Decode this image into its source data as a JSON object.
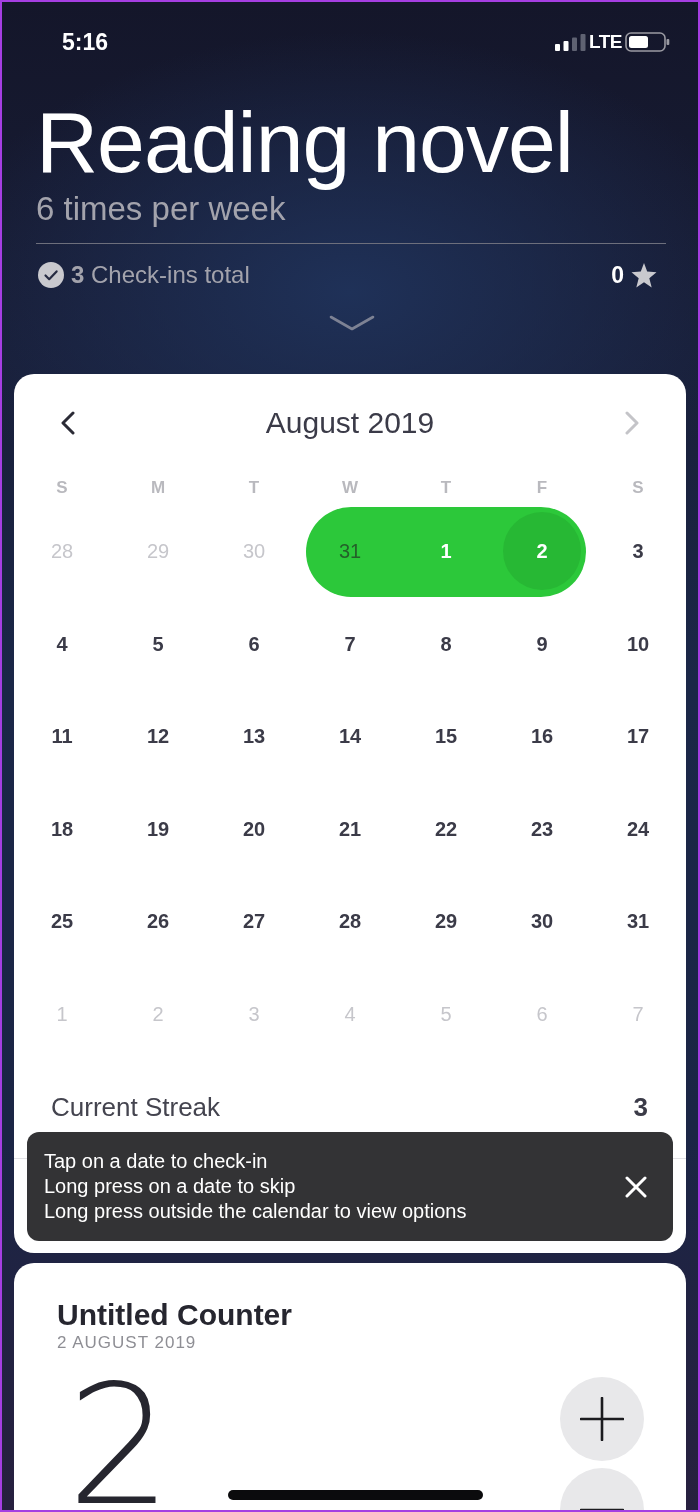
{
  "status_bar": {
    "time": "5:16",
    "network": "LTE"
  },
  "habit": {
    "title": "Reading novel",
    "frequency": "6 times per week",
    "checkins_text": "**3** Check-ins total",
    "star_count": "0"
  },
  "calendar": {
    "month": "August 2019",
    "prev_disabled": false,
    "next_disabled": true,
    "weekdays": [
      "S",
      "M",
      "T",
      "W",
      "T",
      "F",
      "S"
    ],
    "weeks": [
      [
        {
          "day": "28",
          "in_month": false,
          "checked": false,
          "today": false
        },
        {
          "day": "29",
          "in_month": false,
          "checked": false,
          "today": false
        },
        {
          "day": "30",
          "in_month": false,
          "checked": false,
          "today": false
        },
        {
          "day": "31",
          "in_month": false,
          "checked": true,
          "today": false
        },
        {
          "day": "1",
          "in_month": true,
          "checked": true,
          "today": false
        },
        {
          "day": "2",
          "in_month": true,
          "checked": true,
          "today": true
        },
        {
          "day": "3",
          "in_month": true,
          "checked": false,
          "today": false
        }
      ],
      [
        {
          "day": "4",
          "in_month": true,
          "checked": false,
          "today": false
        },
        {
          "day": "5",
          "in_month": true,
          "checked": false,
          "today": false
        },
        {
          "day": "6",
          "in_month": true,
          "checked": false,
          "today": false
        },
        {
          "day": "7",
          "in_month": true,
          "checked": false,
          "today": false
        },
        {
          "day": "8",
          "in_month": true,
          "checked": false,
          "today": false
        },
        {
          "day": "9",
          "in_month": true,
          "checked": false,
          "today": false
        },
        {
          "day": "10",
          "in_month": true,
          "checked": false,
          "today": false
        }
      ],
      [
        {
          "day": "11",
          "in_month": true,
          "checked": false,
          "today": false
        },
        {
          "day": "12",
          "in_month": true,
          "checked": false,
          "today": false
        },
        {
          "day": "13",
          "in_month": true,
          "checked": false,
          "today": false
        },
        {
          "day": "14",
          "in_month": true,
          "checked": false,
          "today": false
        },
        {
          "day": "15",
          "in_month": true,
          "checked": false,
          "today": false
        },
        {
          "day": "16",
          "in_month": true,
          "checked": false,
          "today": false
        },
        {
          "day": "17",
          "in_month": true,
          "checked": false,
          "today": false
        }
      ],
      [
        {
          "day": "18",
          "in_month": true,
          "checked": false,
          "today": false
        },
        {
          "day": "19",
          "in_month": true,
          "checked": false,
          "today": false
        },
        {
          "day": "20",
          "in_month": true,
          "checked": false,
          "today": false
        },
        {
          "day": "21",
          "in_month": true,
          "checked": false,
          "today": false
        },
        {
          "day": "22",
          "in_month": true,
          "checked": false,
          "today": false
        },
        {
          "day": "23",
          "in_month": true,
          "checked": false,
          "today": false
        },
        {
          "day": "24",
          "in_month": true,
          "checked": false,
          "today": false
        }
      ],
      [
        {
          "day": "25",
          "in_month": true,
          "checked": false,
          "today": false
        },
        {
          "day": "26",
          "in_month": true,
          "checked": false,
          "today": false
        },
        {
          "day": "27",
          "in_month": true,
          "checked": false,
          "today": false
        },
        {
          "day": "28",
          "in_month": true,
          "checked": false,
          "today": false
        },
        {
          "day": "29",
          "in_month": true,
          "checked": false,
          "today": false
        },
        {
          "day": "30",
          "in_month": true,
          "checked": false,
          "today": false
        },
        {
          "day": "31",
          "in_month": true,
          "checked": false,
          "today": false
        }
      ],
      [
        {
          "day": "1",
          "in_month": false,
          "checked": false,
          "today": false
        },
        {
          "day": "2",
          "in_month": false,
          "checked": false,
          "today": false
        },
        {
          "day": "3",
          "in_month": false,
          "checked": false,
          "today": false
        },
        {
          "day": "4",
          "in_month": false,
          "checked": false,
          "today": false
        },
        {
          "day": "5",
          "in_month": false,
          "checked": false,
          "today": false
        },
        {
          "day": "6",
          "in_month": false,
          "checked": false,
          "today": false
        },
        {
          "day": "7",
          "in_month": false,
          "checked": false,
          "today": false
        }
      ]
    ]
  },
  "stats": [
    {
      "label": "Current Streak",
      "value": "3"
    }
  ],
  "toast": {
    "lines": [
      "Tap on a date to check-in",
      "Long press on a date to skip",
      "Long press outside the calendar to view options"
    ]
  },
  "counter": {
    "title": "Untitled Counter",
    "date": "2 AUGUST 2019",
    "value": "2"
  }
}
